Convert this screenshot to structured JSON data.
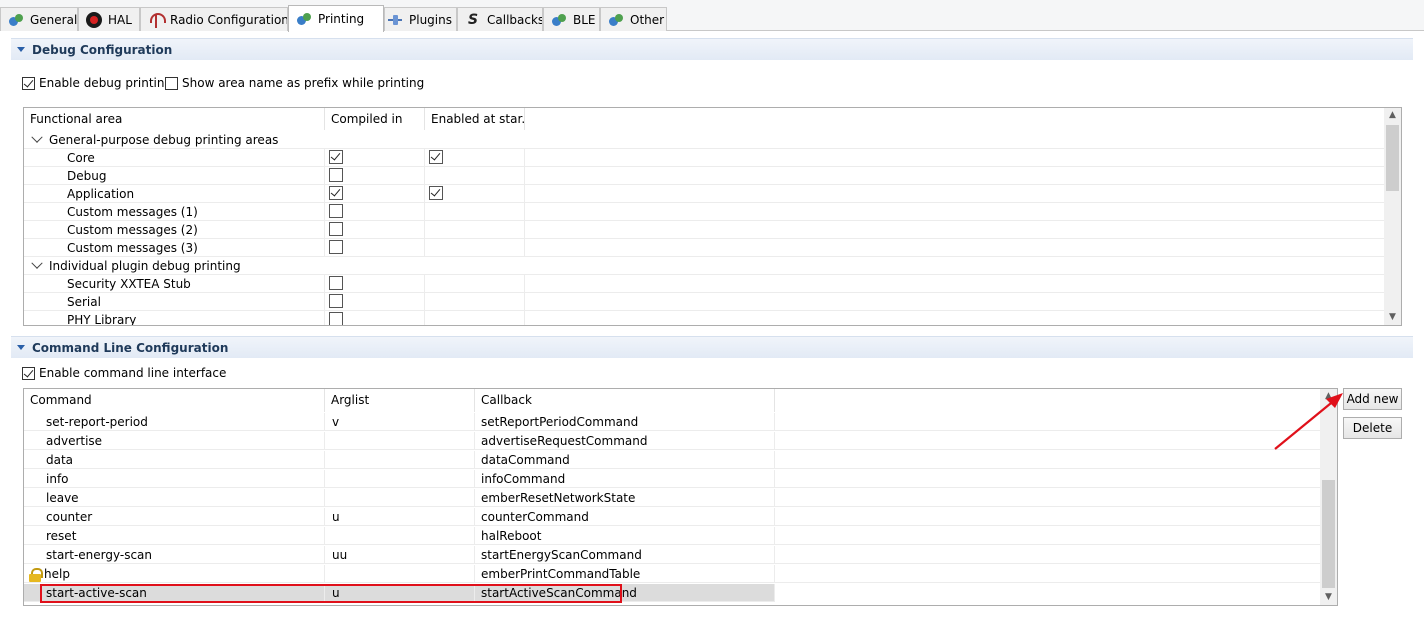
{
  "tabs": [
    {
      "label": "General",
      "icon": "leaf-icon"
    },
    {
      "label": "HAL",
      "icon": "hal-icon"
    },
    {
      "label": "Radio Configuration",
      "icon": "antenna-icon"
    },
    {
      "label": "Printing",
      "icon": "leaf-icon",
      "active": true
    },
    {
      "label": "Plugins",
      "icon": "plug-icon"
    },
    {
      "label": "Callbacks",
      "icon": "callback-icon"
    },
    {
      "label": "BLE",
      "icon": "leaf-icon"
    },
    {
      "label": "Other",
      "icon": "leaf-icon"
    }
  ],
  "debug": {
    "title": "Debug Configuration",
    "enable_label": "Enable debug printing",
    "enable_checked": true,
    "prefix_label": "Show area name as prefix while printing",
    "prefix_checked": false,
    "columns": [
      "Functional area",
      "Compiled in",
      "Enabled at star..."
    ],
    "rows": [
      {
        "name": "General-purpose debug printing areas",
        "group": true
      },
      {
        "name": "Core",
        "compiled": true,
        "enabled": true
      },
      {
        "name": "Debug",
        "compiled": false,
        "enabled": null
      },
      {
        "name": "Application",
        "compiled": true,
        "enabled": true
      },
      {
        "name": "Custom messages (1)",
        "compiled": false,
        "enabled": null
      },
      {
        "name": "Custom messages (2)",
        "compiled": false,
        "enabled": null
      },
      {
        "name": "Custom messages (3)",
        "compiled": false,
        "enabled": null
      },
      {
        "name": "Individual plugin debug printing",
        "group": true
      },
      {
        "name": "Security XXTEA Stub",
        "compiled": false,
        "enabled": null
      },
      {
        "name": "Serial",
        "compiled": false,
        "enabled": null
      },
      {
        "name": "PHY Library",
        "compiled": false,
        "enabled": null
      }
    ]
  },
  "cli": {
    "title": "Command Line Configuration",
    "enable_label": "Enable command line interface",
    "enable_checked": true,
    "columns": [
      "Command",
      "Arglist",
      "Callback"
    ],
    "rows": [
      {
        "command": "set-report-period",
        "arglist": "v",
        "callback": "setReportPeriodCommand"
      },
      {
        "command": "advertise",
        "arglist": "",
        "callback": "advertiseRequestCommand"
      },
      {
        "command": "data",
        "arglist": "",
        "callback": "dataCommand"
      },
      {
        "command": "info",
        "arglist": "",
        "callback": "infoCommand"
      },
      {
        "command": "leave",
        "arglist": "",
        "callback": "emberResetNetworkState"
      },
      {
        "command": "counter",
        "arglist": "u",
        "callback": "counterCommand"
      },
      {
        "command": "reset",
        "arglist": "",
        "callback": "halReboot"
      },
      {
        "command": "start-energy-scan",
        "arglist": "uu",
        "callback": "startEnergyScanCommand"
      },
      {
        "command": "help",
        "arglist": "",
        "callback": "emberPrintCommandTable",
        "locked": true
      },
      {
        "command": "start-active-scan",
        "arglist": "u",
        "callback": "startActiveScanCommand",
        "selected": true
      }
    ],
    "add_label": "Add new",
    "delete_label": "Delete"
  },
  "colors": {
    "highlight": "#e0101a",
    "section_header": "#e2eaf5",
    "selected_row": "#dcdcdc"
  }
}
